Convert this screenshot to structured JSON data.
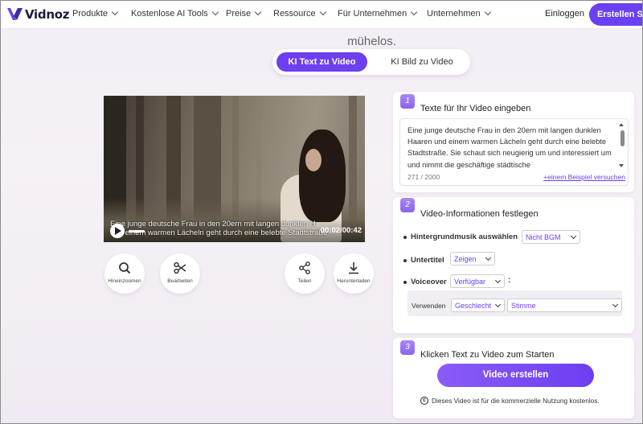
{
  "nav": {
    "brand": "Vidnoz",
    "menu": [
      {
        "label": "Produkte"
      },
      {
        "label": "Kostenlose AI Tools"
      },
      {
        "label": "Preise"
      },
      {
        "label": "Ressource"
      },
      {
        "label": "Für Unternehmen"
      },
      {
        "label": "Unternehmen"
      }
    ],
    "login": "Einloggen",
    "signup": "Erstellen Sie"
  },
  "headline_fragment": "mühelos.",
  "mode_switch": {
    "active": "KI Text zu Video",
    "inactive": "KI Bild zu Video"
  },
  "video": {
    "subtitle_line1": "Eine junge deutsche Frau in den 20ern mit langen dunklen H",
    "subtitle_line2": "und einem warmen Lächeln geht durch eine belebte Stadtstraße",
    "timecode": "00:02/00:42"
  },
  "actions": [
    {
      "label": "Hineinzoomen",
      "icon": "magnifier-icon"
    },
    {
      "label": "Bearbeiten",
      "icon": "scissors-icon"
    },
    {
      "label": "Teilen",
      "icon": "share-icon"
    },
    {
      "label": "Herunterladen",
      "icon": "download-icon"
    }
  ],
  "step1": {
    "number": "1",
    "title": "Texte für Ihr Video eingeben",
    "text": "Eine junge deutsche Frau in den 20ern mit langen dunklen Haaren und einem warmen Lächeln geht durch eine belebte Stadtstraße. Sie schaut sich neugierig um und interessiert um und nimmt die geschäftige städtische",
    "counter": "271 / 2000",
    "example_link": "+einem Beispiel versuchen"
  },
  "step2": {
    "number": "2",
    "title": "Video-Informationen festlegen",
    "bgm_label": "Hintergrundmusik auswählen",
    "bgm_value": "Nicht BGM",
    "subtitle_label": "Untertitel",
    "subtitle_value": "Zeigen",
    "voiceover_label": "Voiceover",
    "voiceover_value": "Verfügbar",
    "colon": ":",
    "use_label": "Verwenden",
    "gender_value": "Geschlecht",
    "voice_value": "Stimme"
  },
  "step3": {
    "number": "3",
    "title": "Klicken Text zu Video zum Starten",
    "button": "Video erstellen",
    "note": "Dieses Video ist für die kommerzielle Nutzung kostenlos.",
    "note_icon": "copyright-icon"
  },
  "colors": {
    "accent": "#6b3ff2",
    "background": "#f3eef6"
  }
}
